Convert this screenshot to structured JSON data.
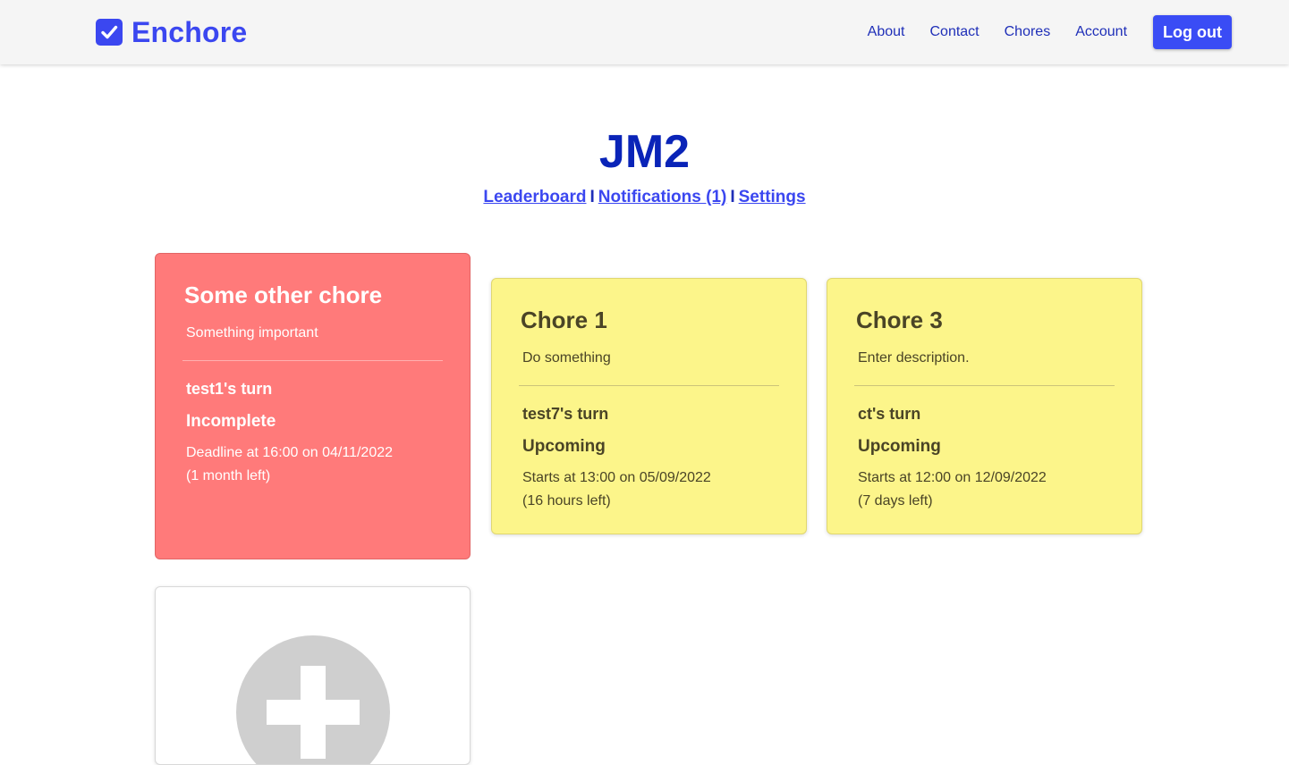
{
  "colors": {
    "brand": "#3b47f0",
    "nav_link": "#1f2fb8",
    "title": "#0a24b8",
    "subnav_link": "#3b47f0",
    "logout_bg": "#3a4cf5",
    "add_circle": "#cfcfcf"
  },
  "navbar": {
    "brand_name": "Enchore",
    "brand_icon": "check-square-icon",
    "links": [
      "About",
      "Contact",
      "Chores",
      "Account"
    ],
    "logout_label": "Log out"
  },
  "group": {
    "title": "JM2",
    "links": {
      "leaderboard": "Leaderboard",
      "notifications": "Notifications (1)",
      "settings": "Settings"
    },
    "separator": "I"
  },
  "chores": [
    {
      "title": "Some other chore",
      "description": "Something important",
      "turn": "test1's turn",
      "status": "Incomplete",
      "time_line1": "Deadline at 16:00 on 04/11/2022",
      "time_line2": "(1 month left)",
      "color": "#ff7a7a"
    },
    {
      "title": "Chore 1",
      "description": "Do something",
      "turn": "test7's turn",
      "status": "Upcoming",
      "time_line1": "Starts at 13:00 on 05/09/2022",
      "time_line2": "(16 hours left)",
      "color": "#fcf58a"
    },
    {
      "title": "Chore 3",
      "description": "Enter description.",
      "turn": "ct's turn",
      "status": "Upcoming",
      "time_line1": "Starts at 12:00 on 12/09/2022",
      "time_line2": "(7 days left)",
      "color": "#fcf58a"
    }
  ],
  "add_chore_icon": "plus-circle-icon"
}
